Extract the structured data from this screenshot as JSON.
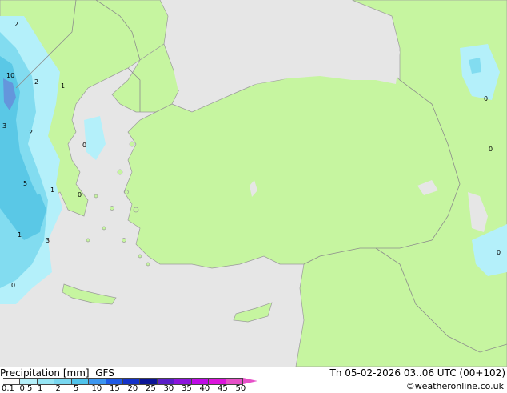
{
  "map": {
    "colors": {
      "sea": "#e6e6e6",
      "land": "#c6f5a0",
      "coast": "#9a9a9a",
      "border": "#8c8c8c",
      "precip_light": "#b4f0fa",
      "precip_mid": "#82dcf0",
      "precip_heavy": "#5ac8e6",
      "precip_max": "#6496dc"
    },
    "contour_labels": [
      {
        "id": "a",
        "text": "2"
      },
      {
        "id": "b",
        "text": "10"
      },
      {
        "id": "c",
        "text": "2"
      },
      {
        "id": "d",
        "text": "1"
      },
      {
        "id": "e",
        "text": "3"
      },
      {
        "id": "f",
        "text": "2"
      },
      {
        "id": "g",
        "text": "0"
      },
      {
        "id": "h",
        "text": "5"
      },
      {
        "id": "i",
        "text": "1"
      },
      {
        "id": "j",
        "text": "0"
      },
      {
        "id": "k",
        "text": "1"
      },
      {
        "id": "l",
        "text": "3"
      },
      {
        "id": "m",
        "text": "0"
      },
      {
        "id": "n",
        "text": "0"
      },
      {
        "id": "o",
        "text": "0"
      },
      {
        "id": "p",
        "text": "0"
      }
    ]
  },
  "footer": {
    "title": "Precipitation [mm]",
    "model": "GFS",
    "datetime": "Th 05-02-2026 03..06 UTC (00+102)",
    "credit": "©weatheronline.co.uk"
  },
  "legend": {
    "ticks": [
      "0.1",
      "0.5",
      "1",
      "2",
      "5",
      "10",
      "15",
      "20",
      "25",
      "30",
      "35",
      "40",
      "45",
      "50"
    ],
    "colors": [
      "#fafafa",
      "#b4f0fa",
      "#96e6f5",
      "#78d7f0",
      "#50c3eb",
      "#3c96f0",
      "#1e5ae6",
      "#1432c8",
      "#0a1496",
      "#5a1ec8",
      "#8c14dc",
      "#be0ae6",
      "#dc14dc",
      "#e650c8"
    ]
  }
}
